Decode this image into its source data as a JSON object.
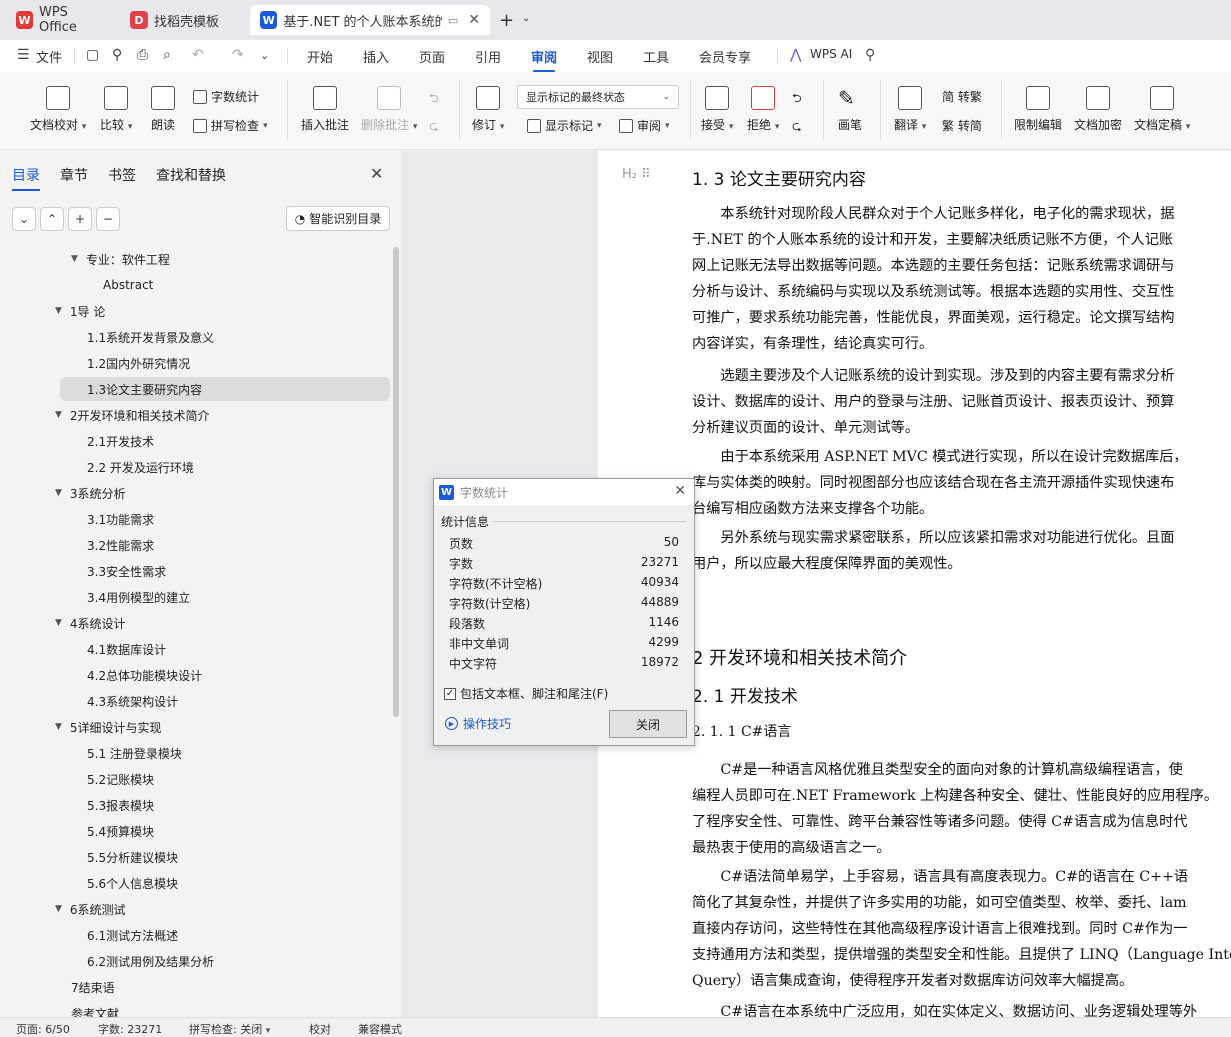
{
  "tabs": [
    {
      "label": "WPS Office",
      "logo": "W",
      "color": "#e03a3a"
    },
    {
      "label": "找稻壳模板",
      "logo": "D",
      "color": "#e0424a"
    },
    {
      "label": "基于.NET 的个人账本系统的设",
      "logo": "W",
      "color": "#1a5ad6"
    }
  ],
  "menu": {
    "file": "文件",
    "items": [
      "开始",
      "插入",
      "页面",
      "引用",
      "审阅",
      "视图",
      "工具",
      "会员专享"
    ],
    "active": "审阅",
    "ai": "WPS AI"
  },
  "ribbon": {
    "doc_check": "文档校对",
    "compare": "比较",
    "read": "朗读",
    "word_count": "字数统计",
    "spell_check": "拼写检查",
    "insert_comment": "插入批注",
    "delete_comment": "删除批注",
    "revise": "修订",
    "markup_state": "显示标记的最终状态",
    "show_markup": "显示标记",
    "review": "审阅",
    "accept": "接受",
    "reject": "拒绝",
    "pen": "画笔",
    "translate": "翻译",
    "to_traditional": "简 转繁",
    "to_simplified": "繁 转简",
    "restrict_edit": "限制编辑",
    "encrypt": "文档加密",
    "finalize": "文档定稿"
  },
  "nav": {
    "tabs": [
      "目录",
      "章节",
      "书签",
      "查找和替换"
    ],
    "smart_toc": "智能识别目录",
    "toc": [
      {
        "label": "专业：软件工程",
        "level": 2,
        "tri": true
      },
      {
        "label": "Abstract",
        "level": 3,
        "tri": false
      },
      {
        "label": "1导 论",
        "level": 1,
        "tri": true
      },
      {
        "label": "1.1系统开发背景及意义",
        "level": 2,
        "tri": false
      },
      {
        "label": "1.2国内外研究情况",
        "level": 2,
        "tri": false
      },
      {
        "label": "1.3论文主要研究内容",
        "level": 2,
        "tri": false,
        "selected": true
      },
      {
        "label": "2开发环境和相关技术简介",
        "level": 1,
        "tri": true
      },
      {
        "label": "2.1开发技术",
        "level": 2,
        "tri": false
      },
      {
        "label": "2.2 开发及运行环境",
        "level": 2,
        "tri": false
      },
      {
        "label": "3系统分析",
        "level": 1,
        "tri": true
      },
      {
        "label": "3.1功能需求",
        "level": 2,
        "tri": false
      },
      {
        "label": "3.2性能需求",
        "level": 2,
        "tri": false
      },
      {
        "label": "3.3安全性需求",
        "level": 2,
        "tri": false
      },
      {
        "label": "3.4用例模型的建立",
        "level": 2,
        "tri": false
      },
      {
        "label": "4系统设计",
        "level": 1,
        "tri": true
      },
      {
        "label": "4.1数据库设计",
        "level": 2,
        "tri": false
      },
      {
        "label": "4.2总体功能模块设计",
        "level": 2,
        "tri": false
      },
      {
        "label": "4.3系统架构设计",
        "level": 2,
        "tri": false
      },
      {
        "label": "5详细设计与实现",
        "level": 1,
        "tri": true
      },
      {
        "label": "5.1 注册登录模块",
        "level": 2,
        "tri": false
      },
      {
        "label": "5.2记账模块",
        "level": 2,
        "tri": false
      },
      {
        "label": "5.3报表模块",
        "level": 2,
        "tri": false
      },
      {
        "label": "5.4预算模块",
        "level": 2,
        "tri": false
      },
      {
        "label": "5.5分析建议模块",
        "level": 2,
        "tri": false
      },
      {
        "label": "5.6个人信息模块",
        "level": 2,
        "tri": false
      },
      {
        "label": "6系统测试",
        "level": 1,
        "tri": true
      },
      {
        "label": "6.1测试方法概述",
        "level": 2,
        "tri": false
      },
      {
        "label": "6.2测试用例及结果分析",
        "level": 2,
        "tri": false
      },
      {
        "label": "7结束语",
        "level": 1,
        "tri": false
      },
      {
        "label": "参考文献",
        "level": 1,
        "tri": false
      }
    ]
  },
  "doc": {
    "heading_1_3": "1. 3 论文主要研究内容",
    "p1": [
      "　　本系统针对现阶段人民群众对于个人记账多样化，电子化的需求现状，据",
      "于.NET 的个人账本系统的设计和开发，主要解决纸质记账不方便，个人记账",
      "网上记账无法导出数据等问题。本选题的主要任务包括：记账系统需求调研与",
      "分析与设计、系统编码与实现以及系统测试等。根据本选题的实用性、交互性",
      "可推广，要求系统功能完善，性能优良，界面美观，运行稳定。论文撰写结构",
      "内容详实，有条理性，结论真实可行。"
    ],
    "p2": [
      "　　选题主要涉及个人记账系统的设计到实现。涉及到的内容主要有需求分析",
      "设计、数据库的设计、用户的登录与注册、记账首页设计、报表页设计、预算",
      "分析建议页面的设计、单元测试等。"
    ],
    "p3": [
      "　　由于本系统采用  ASP.NET MVC 模式进行实现，所以在设计完数据库后，",
      "库与实体类的映射。同时视图部分也应该结合现在各主流开源插件实现快速布",
      "台编写相应函数方法来支撑各个功能。"
    ],
    "p4": [
      "　　另外系统与现实需求紧密联系，所以应该紧扣需求对功能进行优化。且面",
      "用户，所以应最大程度保障界面的美观性。"
    ],
    "heading_2": "2 开发环境和相关技术简介",
    "heading_2_1": "2. 1 开发技术",
    "heading_2_1_1": "2. 1. 1  C#语言",
    "p5": [
      "　　C#是一种语言风格优雅且类型安全的面向对象的计算机高级编程语言，使",
      "编程人员即可在.NET Framework 上构建各种安全、健壮、性能良好的应用程序。",
      "了程序安全性、可靠性、跨平台兼容性等诸多问题。使得  C#语言成为信息时代",
      "最热衷于使用的高级语言之一。"
    ],
    "p6": [
      "　　C#语法简单易学，上手容易，语言具有高度表现力。C#的语言在  C++语",
      "简化了其复杂性，并提供了许多实用的功能，如可空值类型、枚举、委托、lam",
      "直接内存访问，这些特性在其他高级程序设计语言上很难找到。同时  C#作为一",
      "支持通用方法和类型，提供增强的类型安全和性能。且提供了  LINQ（Language Inte",
      "Query）语言集成查询，使得程序开发者对数据库访问效率大幅提高。"
    ],
    "p7": [
      "　　C#语言在本系统中广泛应用，如在实体定义、数据访问、业务逻辑处理等外"
    ]
  },
  "dialog": {
    "title": "字数统计",
    "section": "统计信息",
    "rows": [
      {
        "label": "页数",
        "value": "50"
      },
      {
        "label": "字数",
        "value": "23271"
      },
      {
        "label": "字符数(不计空格)",
        "value": "40934"
      },
      {
        "label": "字符数(计空格)",
        "value": "44889"
      },
      {
        "label": "段落数",
        "value": "1146"
      },
      {
        "label": "非中文单词",
        "value": "4299"
      },
      {
        "label": "中文字符",
        "value": "18972"
      }
    ],
    "checkbox_label": "包括文本框、脚注和尾注(F)",
    "checkbox_checked": true,
    "tips": "操作技巧",
    "close": "关闭"
  },
  "status": {
    "page": "页面: 6/50",
    "words": "字数: 23271",
    "spell": "拼写检查: 关闭",
    "proof": "校对",
    "compat": "兼容模式"
  }
}
